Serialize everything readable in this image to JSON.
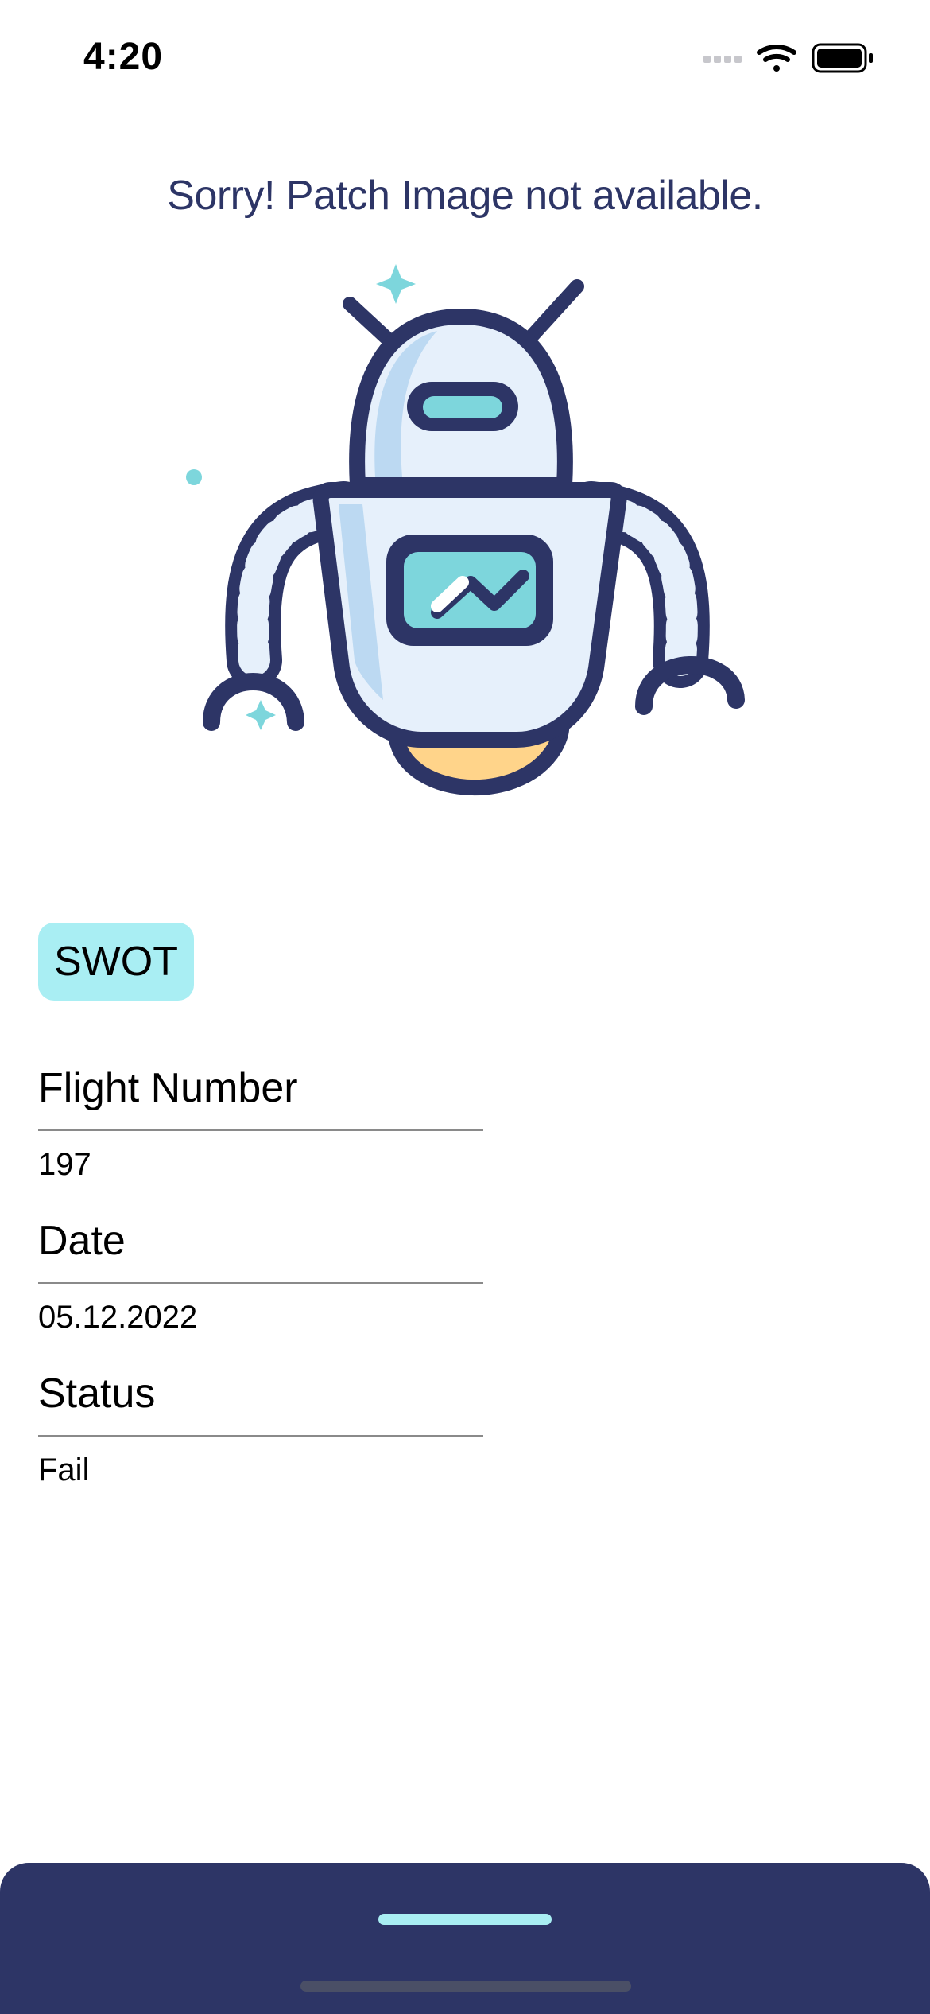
{
  "status_bar": {
    "time": "4:20",
    "icons": [
      "signal-icon",
      "wifi-icon",
      "battery-icon"
    ]
  },
  "message": "Sorry! Patch Image not available.",
  "illustration": "robot-illustration",
  "tag": {
    "label": "SWOT",
    "color": "#a9eef3"
  },
  "fields": [
    {
      "label": "Flight Number",
      "value": "197"
    },
    {
      "label": "Date",
      "value": "05.12.2022"
    },
    {
      "label": "Status",
      "value": "Fail"
    }
  ],
  "colors": {
    "primary": "#2d3566",
    "accent": "#a9eef3",
    "robot_body": "#e6f0fb",
    "robot_shade": "#bcd9f2",
    "robot_screen": "#7dd6dc",
    "robot_base": "#ffd48a"
  }
}
